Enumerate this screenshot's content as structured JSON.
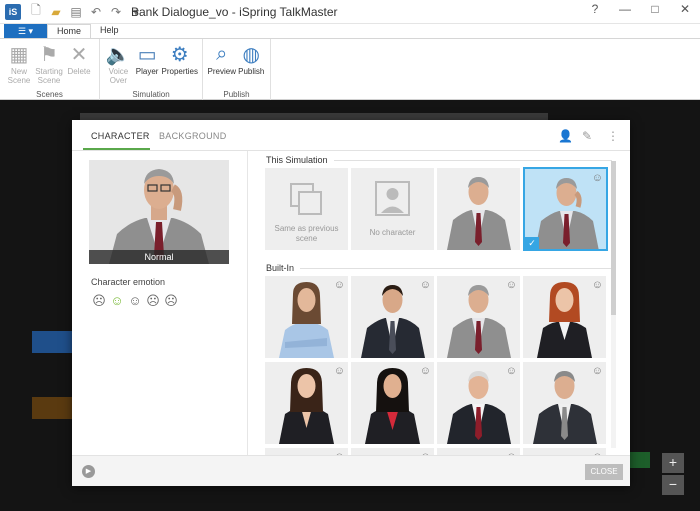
{
  "window": {
    "title": "Bank Dialogue_vo - iSpring TalkMaster",
    "logo": "iSpring",
    "quick_access": [
      "new-file-icon",
      "open-folder-icon",
      "save-icon",
      "undo-icon",
      "redo-icon",
      "customize-icon"
    ],
    "controls": [
      "?",
      "—",
      "□",
      "✕"
    ]
  },
  "ribbon": {
    "file_tab_label": "☰ ▾",
    "tabs": [
      "Home",
      "Help"
    ],
    "active_tab": "Home",
    "groups": {
      "scenes": {
        "label": "Scenes",
        "buttons": [
          {
            "label": "New Scene",
            "icon": "new-scene-icon"
          },
          {
            "label": "Starting Scene",
            "icon": "flag-icon"
          },
          {
            "label": "Delete",
            "icon": "delete-icon"
          }
        ]
      },
      "simulation": {
        "label": "Simulation",
        "buttons": [
          {
            "label": "Voice Over",
            "icon": "speaker-icon"
          },
          {
            "label": "Player",
            "icon": "player-icon"
          },
          {
            "label": "Properties",
            "icon": "gear-icon"
          }
        ]
      },
      "publish": {
        "label": "Publish",
        "buttons": [
          {
            "label": "Preview",
            "icon": "magnifier-icon"
          },
          {
            "label": "Publish",
            "icon": "globe-icon"
          }
        ]
      }
    }
  },
  "dialog": {
    "tabs": {
      "character": "CHARACTER",
      "background": "BACKGROUND"
    },
    "active_tab": "CHARACTER",
    "tools": [
      "add-character-icon",
      "edit-icon",
      "more-icon"
    ],
    "preview_caption": "Normal",
    "emotion_label": "Character emotion",
    "emotions": [
      "☹",
      "☺",
      "☺",
      "☹",
      "☹"
    ],
    "selected_emotion_index": 1,
    "sections": {
      "this_simulation": "This Simulation",
      "built_in": "Built-In"
    },
    "this_simulation_items": [
      {
        "label": "Same as previous scene",
        "type": "placeholder"
      },
      {
        "label": "No character",
        "type": "placeholder"
      },
      {
        "label": "",
        "type": "character"
      },
      {
        "label": "",
        "type": "character",
        "selected": true
      }
    ],
    "face_glyph": "☺",
    "check_glyph": "✓",
    "close_label": "CLOSE",
    "play_glyph": "▶",
    "colors": {
      "accent": "#5aa84b",
      "selection": "#36a6e4",
      "ribbon_file": "#1e6fc0"
    }
  }
}
